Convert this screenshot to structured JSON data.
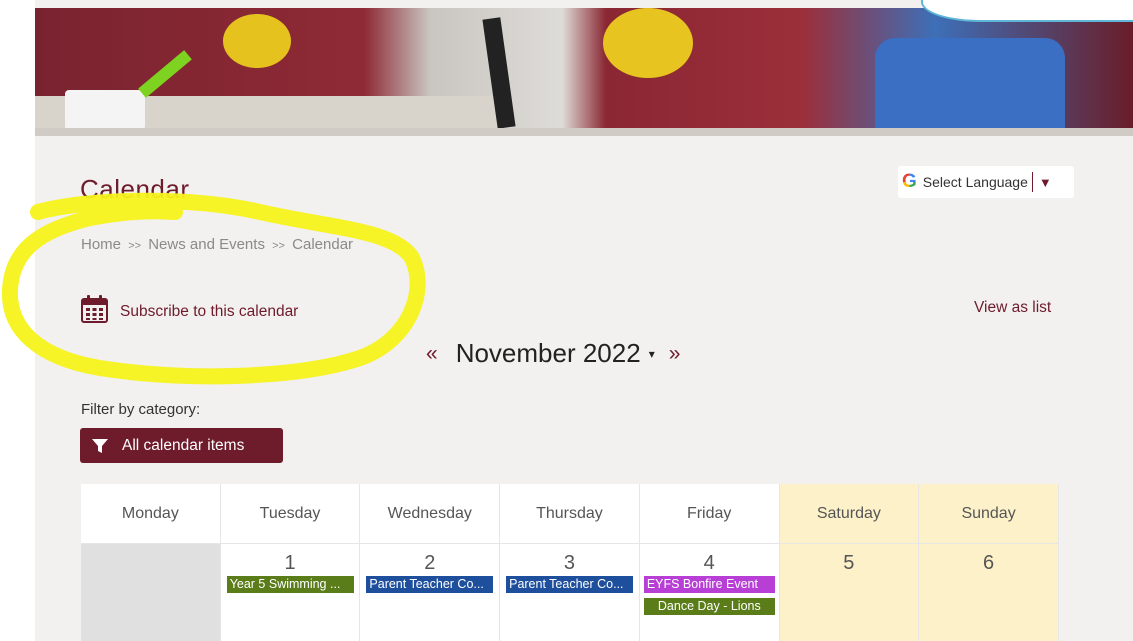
{
  "page": {
    "title": "Calendar"
  },
  "language": {
    "label": "Select Language",
    "g_letter": "G"
  },
  "breadcrumb": [
    "Home",
    ">>",
    "News and Events",
    ">>",
    "Calendar"
  ],
  "subscribe": {
    "label": "Subscribe to this calendar",
    "icon": "calendar-icon"
  },
  "view_list": "View as list",
  "month_nav": {
    "prev": "«",
    "month": "November 2022",
    "caret": "▾",
    "next": "»"
  },
  "filter": {
    "label": "Filter by category:",
    "button": "All calendar items"
  },
  "calendar": {
    "days": [
      "Monday",
      "Tuesday",
      "Wednesday",
      "Thursday",
      "Friday",
      "Saturday",
      "Sunday"
    ],
    "week1": [
      {
        "num": "",
        "events": []
      },
      {
        "num": "1",
        "events": [
          {
            "label": "Year 5 Swimming ...",
            "color": "green"
          }
        ]
      },
      {
        "num": "2",
        "events": [
          {
            "label": "Parent Teacher Co...",
            "color": "blue"
          }
        ]
      },
      {
        "num": "3",
        "events": [
          {
            "label": "Parent Teacher Co...",
            "color": "blue"
          }
        ]
      },
      {
        "num": "4",
        "events": [
          {
            "label": "EYFS Bonfire Event",
            "color": "purple"
          },
          {
            "label": "Dance Day - Lions",
            "color": "green"
          }
        ]
      },
      {
        "num": "5",
        "events": []
      },
      {
        "num": "6",
        "events": []
      }
    ]
  },
  "colors": {
    "brand": "#6e1b2b",
    "weekend": "#fcf1c9",
    "highlight": "#f6f21a"
  }
}
